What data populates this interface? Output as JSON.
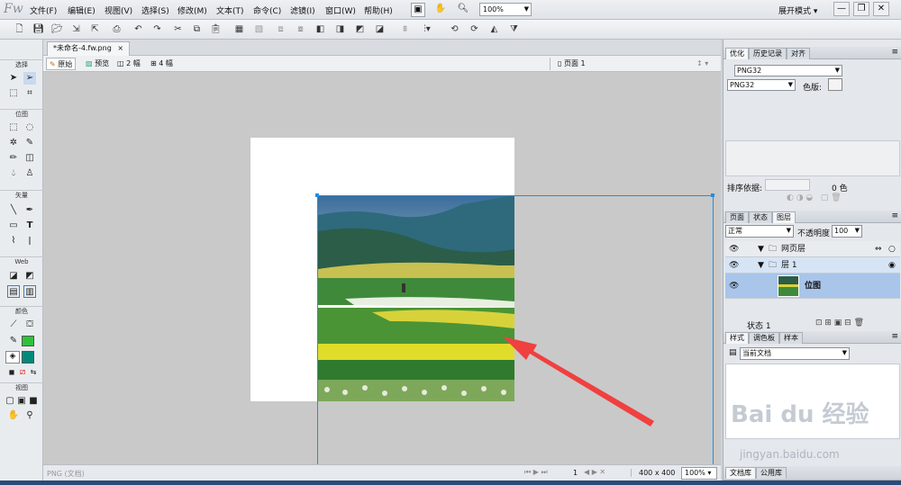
{
  "app": {
    "logo": "Fw",
    "menu": [
      "文件(F)",
      "编辑(E)",
      "视图(V)",
      "选择(S)",
      "修改(M)",
      "文本(T)",
      "命令(C)",
      "滤镜(I)",
      "窗口(W)",
      "帮助(H)"
    ],
    "zoom": "100%",
    "workspace": "展开模式",
    "window_buttons": [
      "—",
      "❐",
      "✕"
    ]
  },
  "tools": {
    "sections": [
      "选择",
      "位图",
      "矢量",
      "Web",
      "颜色",
      "视图"
    ]
  },
  "document": {
    "tab_name": "*未命名-4.fw.png",
    "tab_close": "×",
    "views": [
      "原始",
      "预览",
      "2 幅",
      "4 幅"
    ],
    "page": "页面 1",
    "status_type": "PNG (文档)",
    "frame": "1",
    "size": "400 x 400",
    "zoom": "100%"
  },
  "optimize_panel": {
    "tabs": [
      "优化",
      "历史记录",
      "对齐"
    ],
    "format_preset": "PNG32",
    "format": "PNG32",
    "colors_label": "色版:",
    "sort_label": "排序依据:",
    "color_count": "0 色"
  },
  "layers_panel": {
    "tabs": [
      "页面",
      "状态",
      "图层"
    ],
    "blend_mode": "正常",
    "opacity_label": "不透明度",
    "opacity": "100",
    "layers": [
      {
        "name": "网页层"
      },
      {
        "name": "层 1"
      },
      {
        "name": "位图"
      }
    ],
    "state": "状态 1"
  },
  "styles_panel": {
    "tabs": [
      "样式",
      "调色板",
      "样本"
    ],
    "library": "当前文档"
  },
  "bottom_tabs": [
    "文档库",
    "公用库"
  ],
  "watermark": {
    "brand": "Bai du 经验",
    "url": "jingyan.baidu.com"
  },
  "colors": {
    "accent": "#1f8fe0",
    "arrow": "#f04040",
    "stroke_swatch": "#2ec23a",
    "fill_swatch": "#008a7a"
  }
}
